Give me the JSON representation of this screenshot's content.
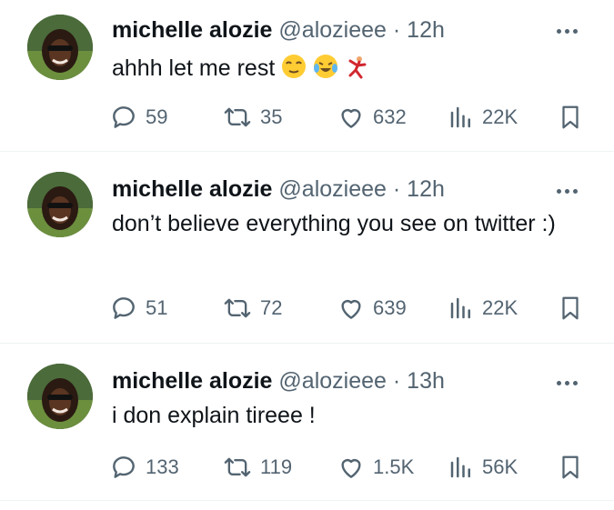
{
  "tweets": [
    {
      "author": {
        "display_name": "michelle alozie",
        "handle": "@alozieee",
        "time": "12h"
      },
      "text": "ahhh let me rest",
      "emojis": [
        "dizzy-face-emoji",
        "tears-of-joy-emoji",
        "person-cartwheeling-emoji"
      ],
      "stats": {
        "replies": "59",
        "reposts": "35",
        "likes": "632",
        "views": "22K"
      }
    },
    {
      "author": {
        "display_name": "michelle alozie",
        "handle": "@alozieee",
        "time": "12h"
      },
      "text": "don’t believe everything you see on twitter :)",
      "emojis": [],
      "stats": {
        "replies": "51",
        "reposts": "72",
        "likes": "639",
        "views": "22K"
      }
    },
    {
      "author": {
        "display_name": "michelle alozie",
        "handle": "@alozieee",
        "time": "13h"
      },
      "text": "i don explain tireee !",
      "emojis": [],
      "stats": {
        "replies": "133",
        "reposts": "119",
        "likes": "1.5K",
        "views": "56K"
      }
    }
  ],
  "meta_separator": "·",
  "colors": {
    "text": "#0f1419",
    "secondary": "#536471",
    "divider": "#eff3f4"
  }
}
